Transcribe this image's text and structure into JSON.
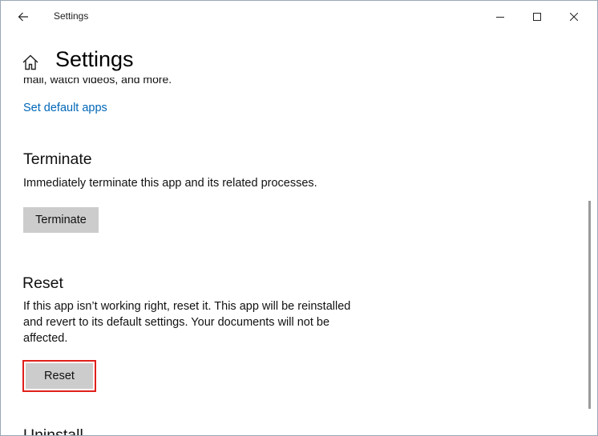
{
  "window": {
    "title": "Settings"
  },
  "header": {
    "title": "Settings"
  },
  "content": {
    "truncated_text": "mail, watch videos, and more.",
    "default_apps_link": "Set default apps",
    "terminate": {
      "title": "Terminate",
      "description": "Immediately terminate this app and its related processes.",
      "button": "Terminate"
    },
    "reset": {
      "title": "Reset",
      "description": "If this app isn’t working right, reset it. This app will be reinstalled and revert to its default settings. Your documents will not be affected.",
      "button": "Reset"
    },
    "next_section_partial": "Uninstall"
  },
  "colors": {
    "link": "#0067b8",
    "highlight": "#e0201b",
    "button_bg": "#cccccc"
  },
  "icons": [
    "back-arrow-icon",
    "minimize-icon",
    "maximize-icon",
    "close-icon",
    "home-icon"
  ]
}
